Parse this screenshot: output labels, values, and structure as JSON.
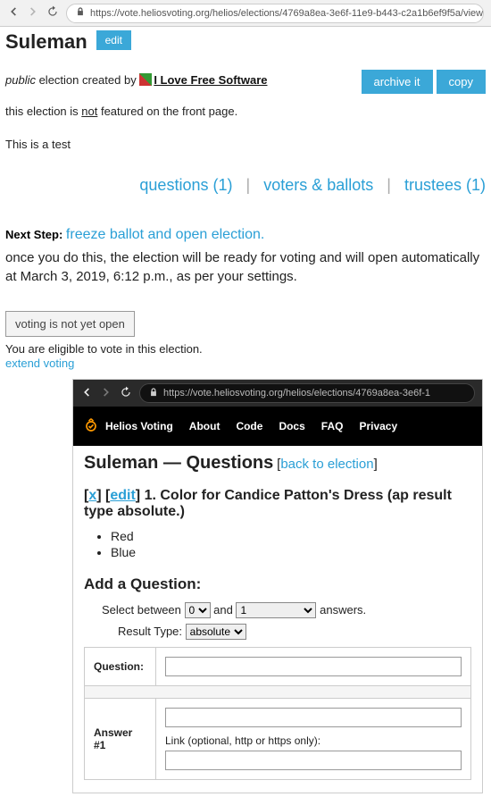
{
  "outer_url": "https://vote.heliosvoting.org/helios/elections/4769a8ea-3e6f-11e9-b443-c2a1b6ef9f5a/view#",
  "title": "Suleman",
  "edit_label": "edit",
  "visibility": "public",
  "created_by_prefix": " election created by ",
  "creator": "I Love Free Software",
  "archive_label": "archive it",
  "copy_label": "copy",
  "featured_prefix": "this election is ",
  "featured_not": "not",
  "featured_suffix": " featured on the front page.",
  "description": "This is a test",
  "tabs": {
    "q": "questions (1)",
    "vb": "voters & ballots",
    "tr": "trustees (1)"
  },
  "next_step_label": "Next Step:",
  "next_step_link": "freeze ballot and open election.",
  "next_step_desc": "once you do this, the election will be ready for voting and will open automatically at March 3, 2019, 6:12 p.m., as per your settings.",
  "voting_btn": "voting is not yet open",
  "eligible": "You are eligible to vote in this election.",
  "extend": "extend voting",
  "inner_url": "https://vote.heliosvoting.org/helios/elections/4769a8ea-3e6f-1",
  "nav": {
    "brand": "Helios Voting",
    "about": "About",
    "code": "Code",
    "docs": "Docs",
    "faq": "FAQ",
    "privacy": "Privacy"
  },
  "qpage_title": "Suleman — Questions",
  "back_link": "back to election",
  "qline_x": "x",
  "qline_edit": "edit",
  "qline_text": "1. Color for Candice Patton's Dress (ap result type absolute.)",
  "options": [
    "Red",
    "Blue"
  ],
  "add_q": "Add a Question:",
  "select_between": "Select between",
  "and": "and",
  "answers_word": "answers.",
  "min_sel": "0",
  "max_sel": "1",
  "result_type_label": "Result Type:",
  "result_type_val": "absolute",
  "form_q": "Question:",
  "form_a1": "Answer #1",
  "link_label": "Link (optional, http or https only):"
}
